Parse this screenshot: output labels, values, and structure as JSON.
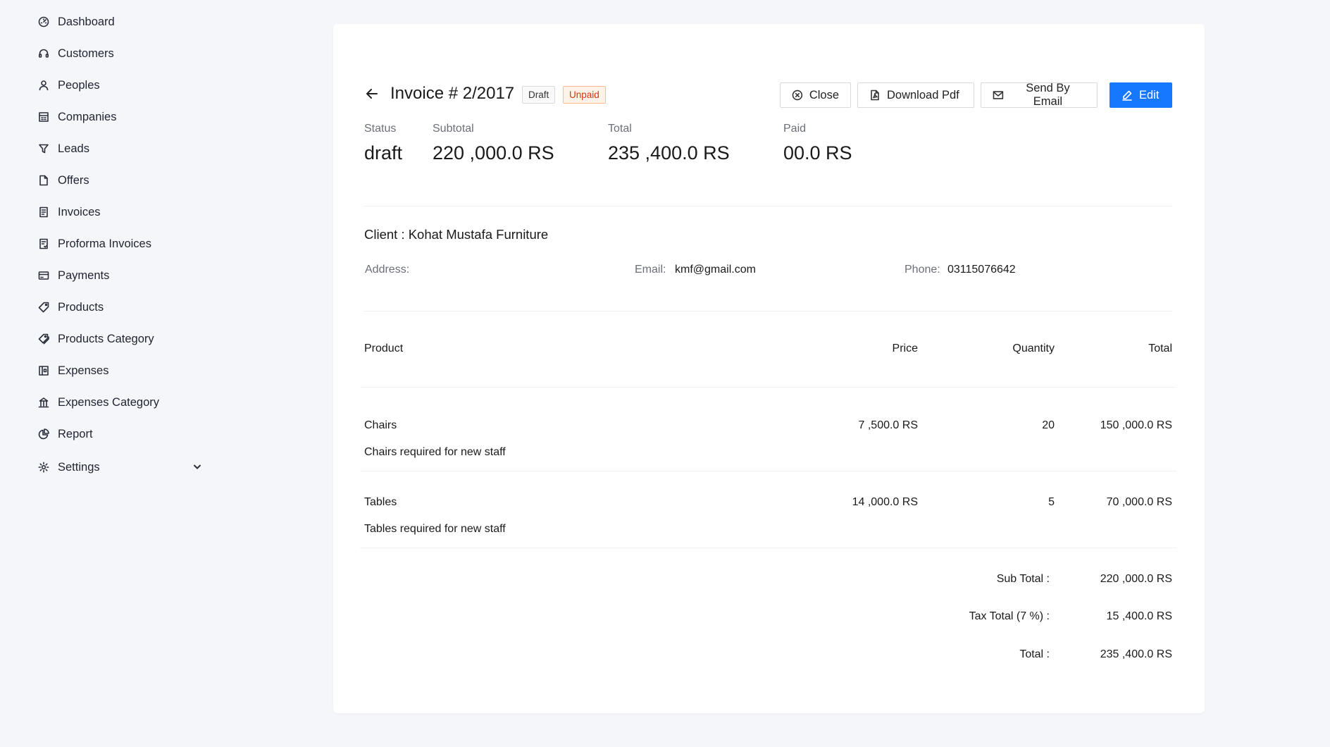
{
  "sidebar": {
    "items": [
      {
        "label": "Dashboard",
        "icon": "dashboard-icon"
      },
      {
        "label": "Customers",
        "icon": "headset-icon"
      },
      {
        "label": "Peoples",
        "icon": "user-icon"
      },
      {
        "label": "Companies",
        "icon": "building-icon"
      },
      {
        "label": "Leads",
        "icon": "filter-icon"
      },
      {
        "label": "Offers",
        "icon": "file-icon"
      },
      {
        "label": "Invoices",
        "icon": "invoice-icon"
      },
      {
        "label": "Proforma Invoices",
        "icon": "file-check-icon"
      },
      {
        "label": "Payments",
        "icon": "credit-card-icon"
      },
      {
        "label": "Products",
        "icon": "tag-icon"
      },
      {
        "label": "Products Category",
        "icon": "tags-icon"
      },
      {
        "label": "Expenses",
        "icon": "wallet-icon"
      },
      {
        "label": "Expenses Category",
        "icon": "bank-icon"
      },
      {
        "label": "Report",
        "icon": "pie-chart-icon"
      },
      {
        "label": "Settings",
        "icon": "gear-icon"
      }
    ]
  },
  "header": {
    "title": "Invoice # 2/2017",
    "tag_draft": "Draft",
    "tag_unpaid": "Unpaid",
    "buttons": {
      "close": "Close",
      "download_pdf": "Download Pdf",
      "send_email": "Send By Email",
      "edit": "Edit"
    }
  },
  "stats": {
    "status_label": "Status",
    "status_value": "draft",
    "subtotal_label": "Subtotal",
    "subtotal_value": "220 ,000.0 RS",
    "total_label": "Total",
    "total_value": "235 ,400.0 RS",
    "paid_label": "Paid",
    "paid_value": "00.0 RS"
  },
  "client": {
    "title": "Client : Kohat Mustafa Furniture",
    "address_label": "Address:",
    "address_value": "",
    "email_label": "Email:",
    "email_value": "kmf@gmail.com",
    "phone_label": "Phone:",
    "phone_value": "03115076642"
  },
  "table": {
    "headers": {
      "product": "Product",
      "price": "Price",
      "quantity": "Quantity",
      "total": "Total"
    },
    "rows": [
      {
        "name": "Chairs",
        "description": "Chairs required for new staff",
        "price": "7 ,500.0 RS",
        "quantity": "20",
        "total": "150 ,000.0 RS"
      },
      {
        "name": "Tables",
        "description": "Tables required for new staff",
        "price": "14 ,000.0 RS",
        "quantity": "5",
        "total": "70 ,000.0 RS"
      }
    ]
  },
  "summary": {
    "subtotal_label": "Sub Total :",
    "subtotal_value": "220 ,000.0 RS",
    "tax_label": "Tax Total (7 %) :",
    "tax_value": "15 ,400.0 RS",
    "total_label": "Total :",
    "total_value": "235 ,400.0 RS"
  },
  "colors": {
    "primary": "#1677ff",
    "unpaid_text": "#d4380d",
    "unpaid_bg": "#fff2e8",
    "background": "#f5f6fa"
  }
}
